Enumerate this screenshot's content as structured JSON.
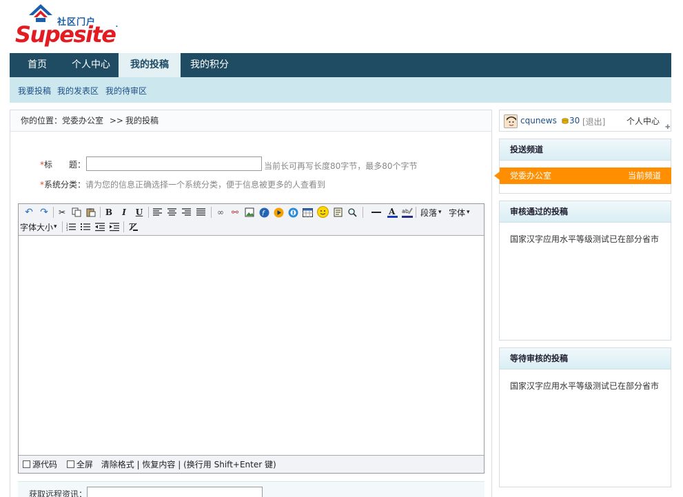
{
  "logo": {
    "cn": "社区门户",
    "brand": "Supesite"
  },
  "nav": {
    "items": [
      "首页",
      "个人中心",
      "我的投稿",
      "我的积分"
    ],
    "active": "我的投稿"
  },
  "subnav": {
    "items": [
      "我要投稿",
      "我的发表区",
      "我的待审区"
    ]
  },
  "breadcrumb": {
    "prefix": "你的位置：",
    "current_section": "党委办公室",
    "sep": ">>",
    "page": "我的投稿"
  },
  "form": {
    "title_label": "标　　题：",
    "title_value": "",
    "title_hint": "当前长可再写长度80字节，最多80个字节",
    "category_label": "系统分类：",
    "category_hint": "请为您的信息正确选择一个系统分类，便于信息被更多的人查看到",
    "required_mark": "*"
  },
  "editor": {
    "toolbar_text": {
      "bold": "B",
      "italic": "I",
      "underline": "U",
      "paragraph": "段落",
      "font": "字体",
      "font_size": "字体大小",
      "dropdown": "▾"
    },
    "footer": {
      "source_code": "源代码",
      "fullscreen": "全屏",
      "clear_format": "清除格式",
      "restore": "恢复内容",
      "newline_tip": "(换行用 Shift+Enter 键)",
      "sep": "|"
    }
  },
  "remote": {
    "label": "获取远程资讯：",
    "value": ""
  },
  "user": {
    "name": "cqunews",
    "credits": "30",
    "logout": "[退出]",
    "center": "个人中心"
  },
  "side": {
    "channel_head": "投送频道",
    "channel_name": "党委办公室",
    "channel_tag": "当前频道",
    "approved_head": "审核通过的投稿",
    "approved_item": "国家汉字应用水平等级测试已在部分省市",
    "pending_head": "等待审核的投稿",
    "pending_item": "国家汉字应用水平等级测试已在部分省市"
  },
  "colors": {
    "nav_bg": "#1f4b63",
    "subnav_bg": "#cde7ee",
    "channel_active": "#ff8f00",
    "required": "#e04a2a",
    "brand_red": "#e31b23",
    "brand_blue": "#1b5faa"
  }
}
